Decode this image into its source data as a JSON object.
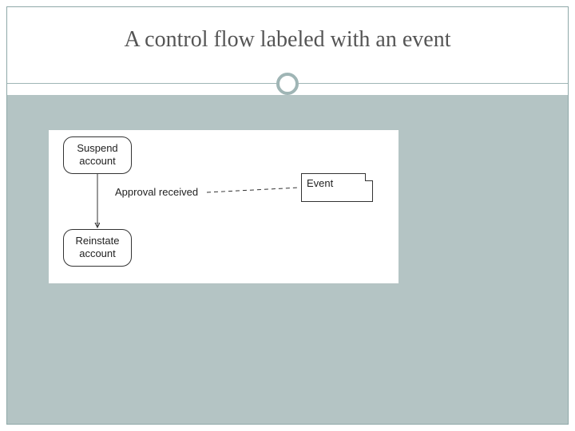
{
  "title": "A control flow labeled with an event",
  "diagram": {
    "activity1": "Suspend\naccount",
    "activity2": "Reinstate\naccount",
    "flow_label": "Approval received",
    "note_text": "Event"
  }
}
